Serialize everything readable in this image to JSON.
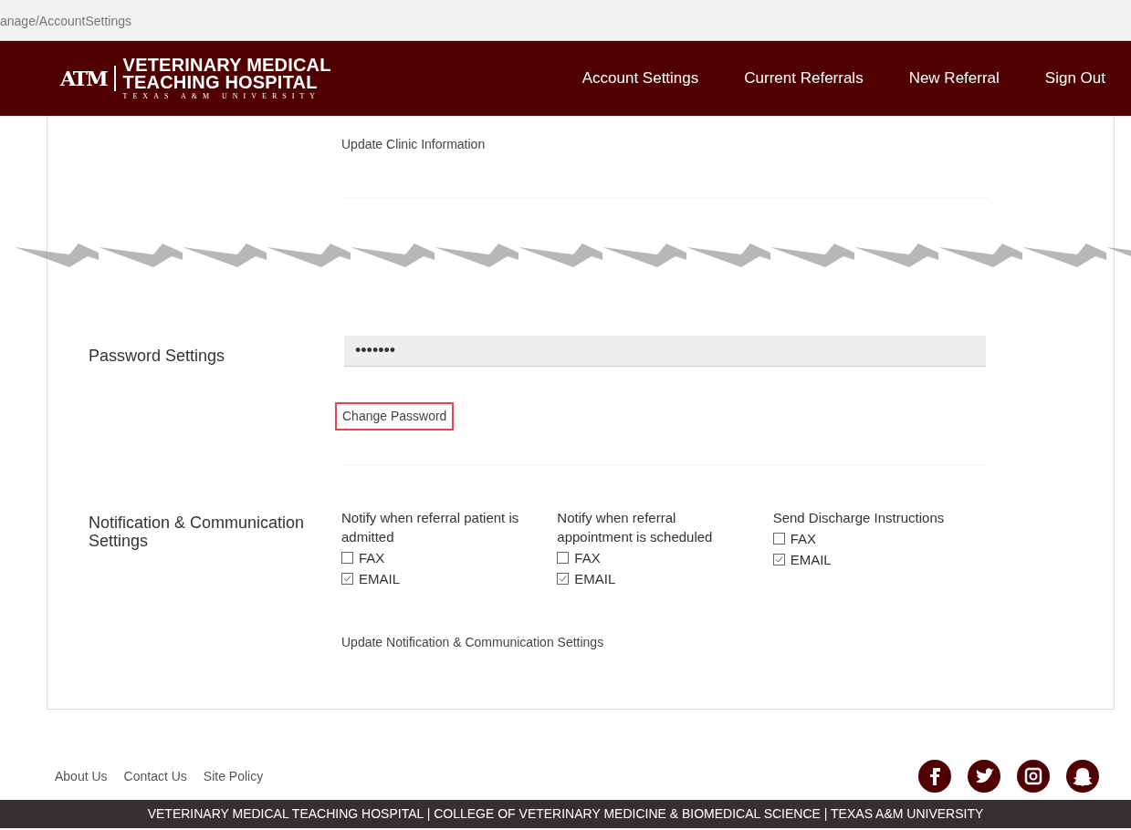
{
  "address_bar": {
    "url": "anage/AccountSettings"
  },
  "header": {
    "logo": {
      "mark": "ATM",
      "line1": "VETERINARY MEDICAL",
      "line2": "TEACHING HOSPITAL",
      "line3": "TEXAS A&M UNIVERSITY"
    },
    "nav": [
      {
        "label": "Account Settings"
      },
      {
        "label": "Current Referrals"
      },
      {
        "label": "New Referral"
      },
      {
        "label": "Sign Out"
      }
    ]
  },
  "clinic_section": {
    "link": "Update Clinic Information"
  },
  "password_section": {
    "label": "Password Settings",
    "value": "•••••••",
    "button": "Change Password",
    "highlighted": true
  },
  "notification_section": {
    "label": "Notification & Communication Settings",
    "groups": [
      {
        "title": "Notify when referral patient is admitted",
        "options": [
          {
            "label": "FAX",
            "checked": false
          },
          {
            "label": "EMAIL",
            "checked": true
          }
        ]
      },
      {
        "title": "Notify when referral appointment is scheduled",
        "options": [
          {
            "label": "FAX",
            "checked": false
          },
          {
            "label": "EMAIL",
            "checked": true
          }
        ]
      },
      {
        "title": "Send Discharge Instructions",
        "options": [
          {
            "label": "FAX",
            "checked": false
          },
          {
            "label": "EMAIL",
            "checked": true
          }
        ]
      }
    ],
    "link": "Update Notification & Communication Settings"
  },
  "footer": {
    "links": [
      "About Us",
      "Contact Us",
      "Site Policy"
    ],
    "social": [
      {
        "kind": "facebook"
      },
      {
        "kind": "twitter"
      },
      {
        "kind": "instagram"
      },
      {
        "kind": "snapchat"
      }
    ],
    "bar_text": "VETERINARY MEDICAL TEACHING HOSPITAL | COLLEGE OF VETERINARY MEDICINE & BIOMEDICAL SCIENCE | TEXAS A&M UNIVERSITY"
  }
}
